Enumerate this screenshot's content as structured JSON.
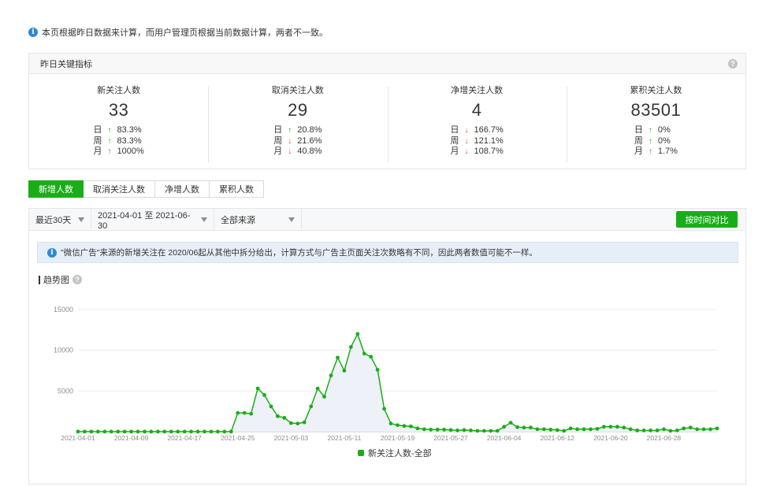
{
  "notice": {
    "text": "本页根据昨日数据来计算，而用户管理页根据当前数据计算，两者不一致。"
  },
  "kpi": {
    "title": "昨日关键指标",
    "help_icon": "question-icon",
    "cards": [
      {
        "label": "新关注人数",
        "value": "33",
        "rows": [
          {
            "period": "日",
            "dir": "up",
            "pct": "83.3%"
          },
          {
            "period": "周",
            "dir": "up",
            "pct": "83.3%"
          },
          {
            "period": "月",
            "dir": "up",
            "pct": "1000%"
          }
        ]
      },
      {
        "label": "取消关注人数",
        "value": "29",
        "rows": [
          {
            "period": "日",
            "dir": "up",
            "pct": "20.8%"
          },
          {
            "period": "周",
            "dir": "down",
            "pct": "21.6%"
          },
          {
            "period": "月",
            "dir": "down",
            "pct": "40.8%"
          }
        ]
      },
      {
        "label": "净增关注人数",
        "value": "4",
        "rows": [
          {
            "period": "日",
            "dir": "down",
            "pct": "166.7%"
          },
          {
            "period": "周",
            "dir": "down",
            "pct": "121.1%"
          },
          {
            "period": "月",
            "dir": "down",
            "pct": "108.7%"
          }
        ]
      },
      {
        "label": "累积关注人数",
        "value": "83501",
        "rows": [
          {
            "period": "日",
            "dir": "up",
            "pct": "0%"
          },
          {
            "period": "周",
            "dir": "up",
            "pct": "0%"
          },
          {
            "period": "月",
            "dir": "up",
            "pct": "1.7%"
          }
        ]
      }
    ]
  },
  "tabs": [
    {
      "label": "新增人数",
      "active": true
    },
    {
      "label": "取消关注人数",
      "active": false
    },
    {
      "label": "净增人数",
      "active": false
    },
    {
      "label": "累积人数",
      "active": false
    }
  ],
  "filters": {
    "range": "最近30天",
    "dates": "2021-04-01 至 2021-06-30",
    "source": "全部来源",
    "compare_button": "按时间对比"
  },
  "chart_tip": "\"微信广告\"来源的新增关注在 2020/06起从其他中拆分给出，计算方式与广告主页面关注次数略有不同，因此两者数值可能不一样。",
  "trend_title": "趋势图",
  "colors": {
    "accent": "#1aad19",
    "down": "#e64340",
    "info": "#2e88d9"
  },
  "chart_data": {
    "type": "area",
    "ylim": [
      0,
      15000
    ],
    "yticks": [
      5000,
      10000,
      15000
    ],
    "xtick_labels": [
      "2021-04-01",
      "2021-04-09",
      "2021-04-17",
      "2021-04-25",
      "2021-05-03",
      "2021-05-11",
      "2021-05-19",
      "2021-05-27",
      "2021-06-04",
      "2021-06-12",
      "2021-06-20",
      "2021-06-28"
    ],
    "legend_position": "bottom",
    "series": [
      {
        "name": "新关注人数-全部",
        "color": "#1aad19",
        "start": "2021-04-01",
        "values": [
          5,
          5,
          5,
          5,
          5,
          5,
          5,
          5,
          5,
          5,
          5,
          5,
          5,
          5,
          5,
          5,
          5,
          5,
          5,
          5,
          5,
          5,
          5,
          5,
          2300,
          2300,
          2200,
          5300,
          4500,
          3100,
          1900,
          1700,
          1050,
          1000,
          1150,
          3100,
          5300,
          4300,
          6900,
          9100,
          7500,
          10400,
          12000,
          9600,
          9200,
          7600,
          2800,
          1000,
          800,
          700,
          650,
          400,
          300,
          250,
          250,
          250,
          200,
          150,
          200,
          150,
          100,
          100,
          100,
          100,
          600,
          1100,
          550,
          500,
          500,
          300,
          300,
          250,
          200,
          100,
          400,
          300,
          300,
          300,
          350,
          600,
          600,
          600,
          500,
          300,
          150,
          150,
          150,
          150,
          300,
          100,
          150,
          400,
          500,
          300,
          300,
          300,
          400
        ]
      }
    ]
  }
}
